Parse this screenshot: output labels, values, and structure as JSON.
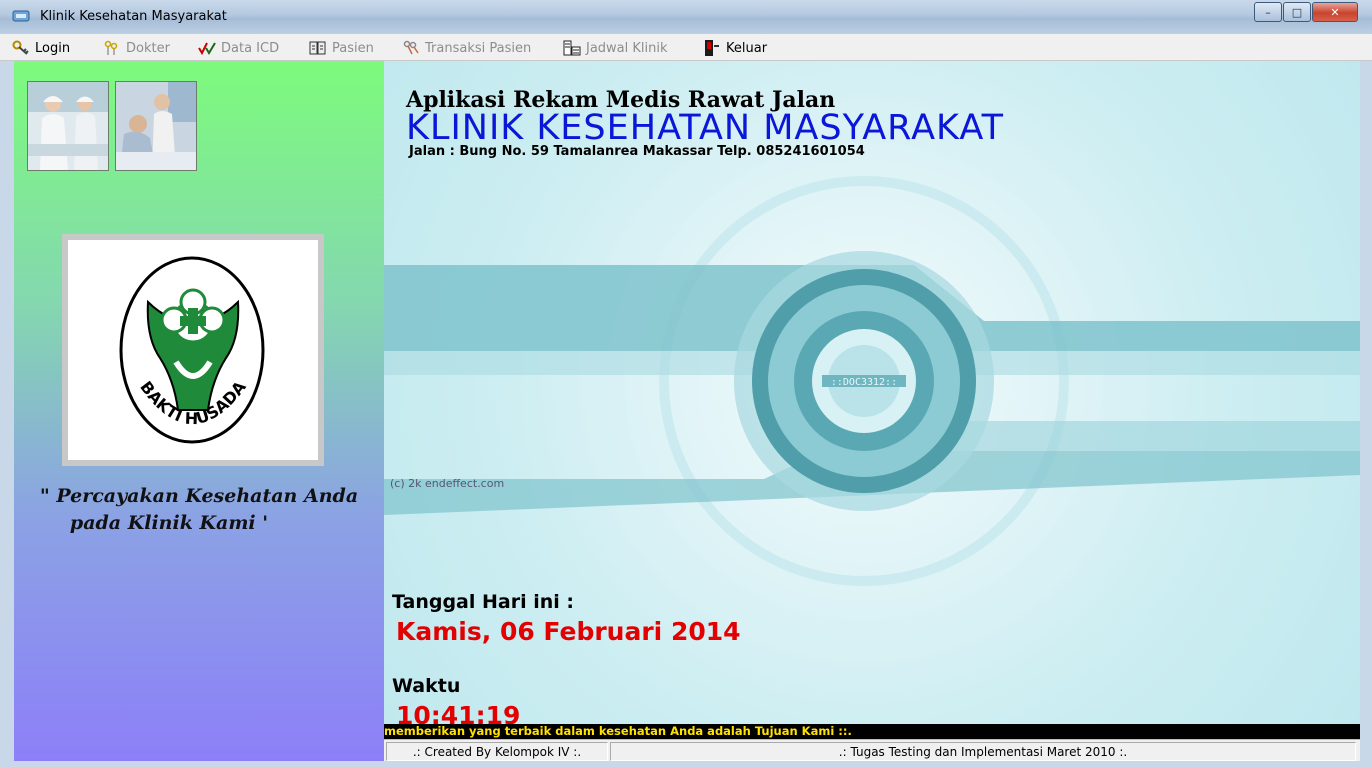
{
  "window": {
    "title": "Klinik Kesehatan Masyarakat",
    "controls": {
      "minimize": "–",
      "maximize": "□",
      "close": "✕"
    }
  },
  "menu": [
    {
      "label": "Login",
      "icon": "key-icon",
      "enabled": true
    },
    {
      "label": "Dokter",
      "icon": "keys-icon",
      "enabled": false
    },
    {
      "label": "Data ICD",
      "icon": "checkmarks-icon",
      "enabled": false
    },
    {
      "label": "Pasien",
      "icon": "book-icon",
      "enabled": false
    },
    {
      "label": "Transaksi Pasien",
      "icon": "keys-icon",
      "enabled": false
    },
    {
      "label": "Jadwal Klinik",
      "icon": "schedule-icon",
      "enabled": false
    },
    {
      "label": "Keluar",
      "icon": "door-icon",
      "enabled": true
    }
  ],
  "left": {
    "logo_text": "BAKTI HUSADA",
    "motto_line1": "\" Percayakan Kesehatan Anda",
    "motto_line2": "pada Klinik Kami '"
  },
  "main": {
    "app_title": "Aplikasi Rekam Medis Rawat Jalan",
    "clinic_name": "KLINIK KESEHATAN MASYARAKAT",
    "address": "Jalan : Bung No. 59 Tamalanrea Makassar Telp. 085241601054",
    "wallpaper_credit": "(c) 2k endeffect.com",
    "date_label": "Tanggal Hari ini :",
    "date_value": "Kamis, 06 Februari 2014",
    "time_label": "Waktu",
    "time_value": "10:41:19"
  },
  "marquee": "memberikan yang terbaik dalam kesehatan Anda adalah Tujuan Kami ::.",
  "status": {
    "left": ".: Created By Kelompok IV :.",
    "right": ".: Tugas Testing dan Implementasi Maret 2010 :."
  },
  "colors": {
    "clinic_name": "#0a16d8",
    "date_time": "#e20000",
    "marquee_text": "#ffe100",
    "logo_green": "#1f8a3a"
  }
}
